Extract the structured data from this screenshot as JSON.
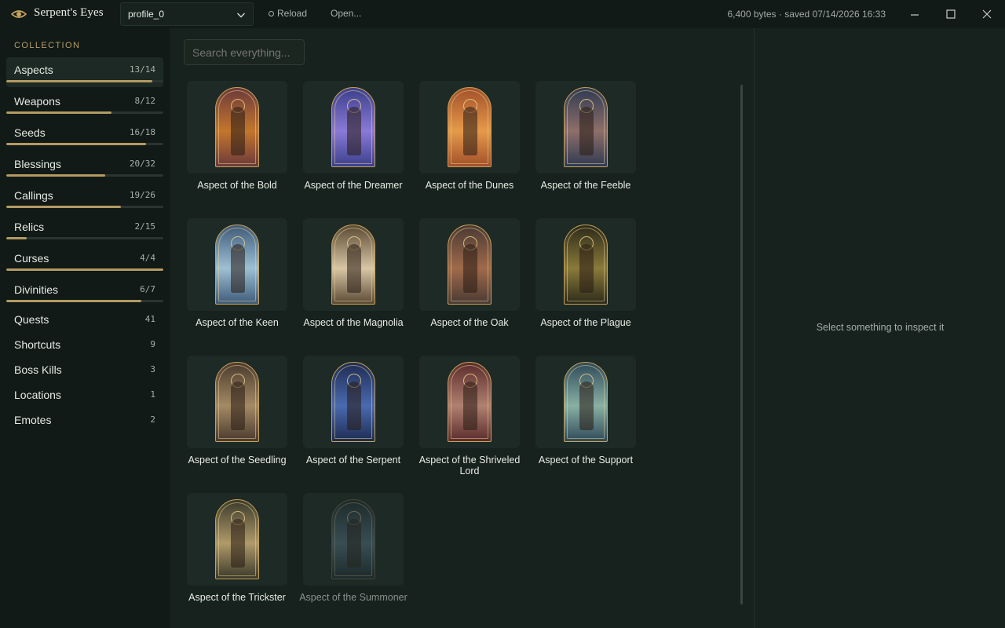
{
  "app": {
    "title": "Serpent's Eyes",
    "logo_icon": "eye-icon",
    "profile": "profile_0",
    "reload_label": "Reload",
    "open_label": "Open...",
    "save_status": "6,400 bytes · saved 07/14/2026 16:33"
  },
  "sidebar": {
    "heading": "COLLECTION",
    "accent_color": "#b49a62",
    "items": [
      {
        "label": "Aspects",
        "count": "13/14",
        "progress": 0.93,
        "active": true
      },
      {
        "label": "Weapons",
        "count": "8/12",
        "progress": 0.67
      },
      {
        "label": "Seeds",
        "count": "16/18",
        "progress": 0.89
      },
      {
        "label": "Blessings",
        "count": "20/32",
        "progress": 0.63
      },
      {
        "label": "Callings",
        "count": "19/26",
        "progress": 0.73
      },
      {
        "label": "Relics",
        "count": "2/15",
        "progress": 0.13
      },
      {
        "label": "Curses",
        "count": "4/4",
        "progress": 1.0
      },
      {
        "label": "Divinities",
        "count": "6/7",
        "progress": 0.86
      },
      {
        "label": "Quests",
        "count": "41"
      },
      {
        "label": "Shortcuts",
        "count": "9"
      },
      {
        "label": "Boss Kills",
        "count": "3"
      },
      {
        "label": "Locations",
        "count": "1"
      },
      {
        "label": "Emotes",
        "count": "2"
      }
    ]
  },
  "search": {
    "placeholder": "Search everything..."
  },
  "aspects": [
    {
      "name": "Aspect of the Bold",
      "colors": [
        "#6b3a3a",
        "#c4762e"
      ],
      "unlocked": true
    },
    {
      "name": "Aspect of the Dreamer",
      "colors": [
        "#3b3f8c",
        "#8a7ad6"
      ],
      "unlocked": true
    },
    {
      "name": "Aspect of the Dunes",
      "colors": [
        "#a2502a",
        "#e59a4a"
      ],
      "unlocked": true
    },
    {
      "name": "Aspect of the Feeble",
      "colors": [
        "#2f3a52",
        "#8e6f6a"
      ],
      "unlocked": true
    },
    {
      "name": "Aspect of the Keen",
      "colors": [
        "#3e5a78",
        "#9ec0d4"
      ],
      "unlocked": true
    },
    {
      "name": "Aspect of the Magnolia",
      "colors": [
        "#5a4a35",
        "#d8c6a4"
      ],
      "unlocked": true
    },
    {
      "name": "Aspect of the Oak",
      "colors": [
        "#4a3a34",
        "#a06a4a"
      ],
      "unlocked": true
    },
    {
      "name": "Aspect of the Plague",
      "colors": [
        "#2c2a1a",
        "#8a7a3a"
      ],
      "unlocked": true
    },
    {
      "name": "Aspect of the Seedling",
      "colors": [
        "#4a3a2e",
        "#a48a64"
      ],
      "unlocked": true
    },
    {
      "name": "Aspect of the Serpent",
      "colors": [
        "#1e2c52",
        "#4a6ab0"
      ],
      "unlocked": true
    },
    {
      "name": "Aspect of the Shriveled Lord",
      "colors": [
        "#5a2c2c",
        "#b08070"
      ],
      "unlocked": true
    },
    {
      "name": "Aspect of the Support",
      "colors": [
        "#2e4a5a",
        "#8ab0a4"
      ],
      "unlocked": true
    },
    {
      "name": "Aspect of the Trickster",
      "colors": [
        "#3a3a2a",
        "#b09a6a"
      ],
      "unlocked": true
    },
    {
      "name": "Aspect of the Summoner",
      "colors": [
        "#1e2c34",
        "#5a7a8a"
      ],
      "unlocked": false
    }
  ],
  "inspector": {
    "empty_text": "Select something to inspect it"
  }
}
